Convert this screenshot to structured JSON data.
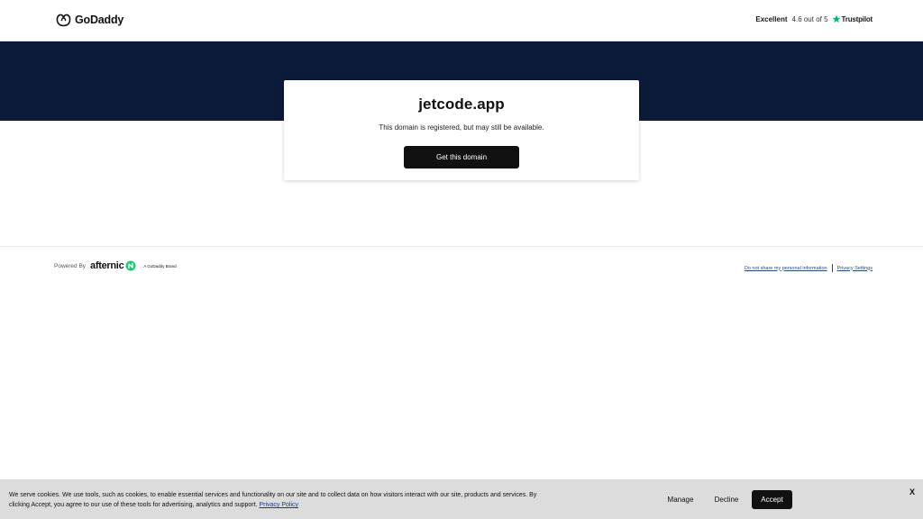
{
  "header": {
    "brand_name": "GoDaddy",
    "rating_label": "Excellent",
    "rating_score": "4.6 out of 5",
    "rating_provider": "Trustpilot"
  },
  "card": {
    "domain": "jetcode.app",
    "description": "This domain is registered, but may still be available.",
    "cta_label": "Get this domain"
  },
  "footer": {
    "powered_by": "Powered By",
    "partner_name": "afternic",
    "partner_tagline": "A GoDaddy Brand",
    "links": [
      "Do not share my personal information",
      "Privacy Settings"
    ]
  },
  "cookie_banner": {
    "text": "We serve cookies. We use tools, such as cookies, to enable essential services and functionality on our site and to collect data on how visitors interact with our site, products and services. By clicking Accept, you agree to our use of these tools for advertising, analytics and support.",
    "policy_link": "Privacy Policy",
    "manage_label": "Manage",
    "decline_label": "Decline",
    "accept_label": "Accept",
    "close_label": "X"
  },
  "colors": {
    "hero_background": "#0a1a38",
    "trustpilot_green": "#00b67a",
    "afternic_green": "#1ec677",
    "button_dark": "#111111"
  }
}
